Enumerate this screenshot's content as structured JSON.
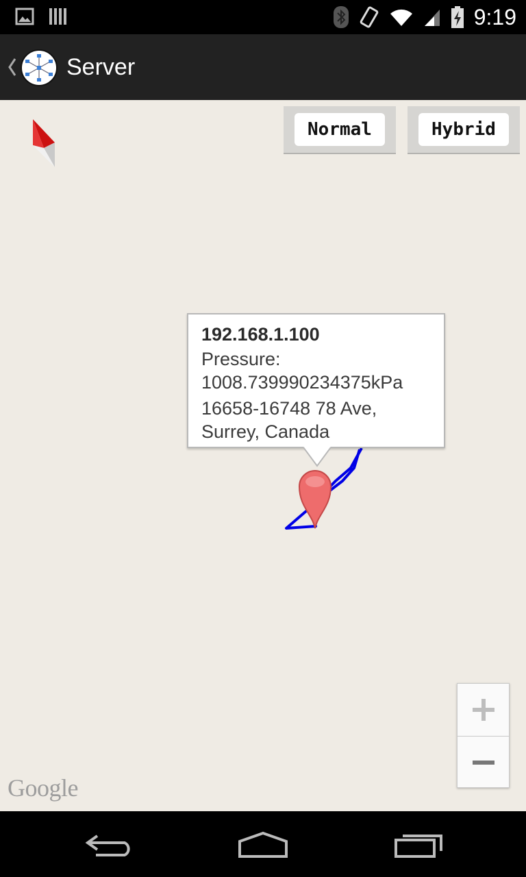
{
  "status_bar": {
    "time": "9:19",
    "left_icons": [
      "image-notification-icon",
      "barcode-notification-icon"
    ],
    "right_icons": [
      "bluetooth-icon",
      "vibrate-icon",
      "wifi-icon",
      "signal-icon",
      "battery-charging-icon"
    ]
  },
  "action_bar": {
    "title": "Server",
    "icons": [
      "up-caret-icon",
      "network-app-icon"
    ]
  },
  "map": {
    "buttons": {
      "normal": "Normal",
      "hybrid": "Hybrid"
    },
    "info_window": {
      "title": "192.168.1.100",
      "pressure_label": "Pressure:",
      "pressure_value": "1008.739990234375kPa",
      "address_line1": "16658-16748 78 Ave,",
      "address_line2": "Surrey, Canada"
    },
    "zoom": {
      "in": "+",
      "out": "−"
    },
    "attribution": "Google",
    "route_color": "#0000e6",
    "marker_color": "#ee6c6c"
  },
  "nav_bar": {
    "icons": [
      "back-icon",
      "home-icon",
      "recent-apps-icon"
    ]
  }
}
